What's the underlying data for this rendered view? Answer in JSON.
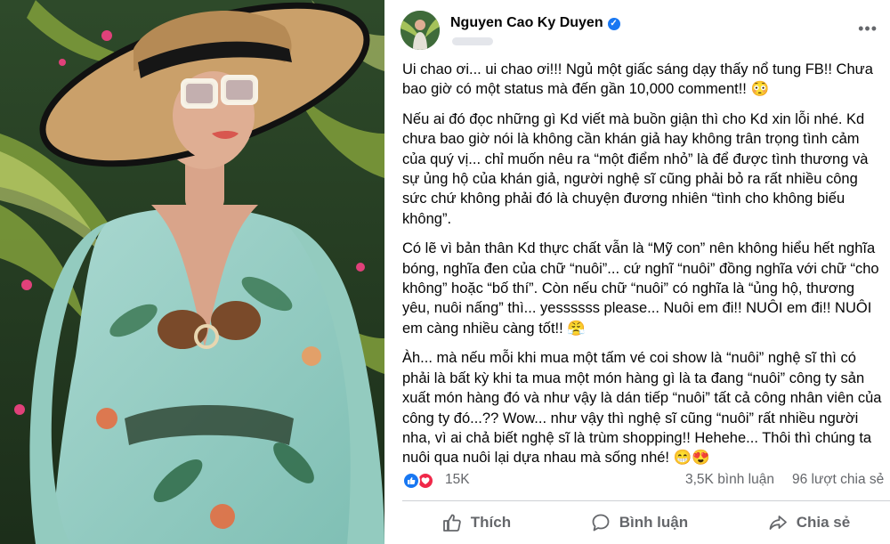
{
  "post": {
    "author": "Nguyen Cao Ky Duyen",
    "paragraphs": [
      "Ui chao ơi... ui chao ơi!!! Ngủ một giấc sáng dạy thấy nổ tung FB!! Chưa bao giờ có một status mà đến gần 10,000 comment!! 😳",
      "Nếu ai đó đọc những gì Kd viết mà buồn giận thì cho Kd xin lỗi nhé. Kd chưa bao giờ nói là không cần khán giả hay không trân trọng tình cảm của quý vị... chỉ muốn nêu ra “một điểm nhỏ” là để được tình thương và sự ủng hộ của khán giả, người nghệ sĩ cũng phải bỏ ra rất nhiều công sức chứ không phải đó là chuyện đương nhiên “tình cho không biếu không”.",
      "Có lẽ vì bản thân Kd thực chất vẫn là “Mỹ con” nên không hiểu hết nghĩa bóng, nghĩa đen của chữ “nuôi”... cứ nghĩ  “nuôi” đồng nghĩa với chữ  “cho không” hoặc “bố thí”.  Còn nếu chữ “nuôi” có nghĩa là “ủng hộ, thương yêu, nuôi nấng” thì... yessssss please... Nuôi em đi!! NUÔI em đi!! NUÔI em càng nhiều càng tốt!! 😤",
      "Àh... mà nếu mỗi khi mua một tấm vé coi show là “nuôi” nghệ sĩ thì có phải là bất kỳ khi ta mua một món hàng gì là ta đang “nuôi” công ty sản xuất món hàng đó và như vậy là dán tiếp “nuôi” tất cả công nhân viên của công ty đó...?? Wow... như vậy thì nghệ sĩ cũng “nuôi” rất nhiều người nha, vì ai chả biết nghệ sĩ là trùm shopping!! Hehehe... Thôi thì chúng ta nuôi qua nuôi lại dựa nhau mà sống nhé! 😁😍"
    ],
    "reactions_count": "15K",
    "comments_count": "3,5K bình luận",
    "shares_count": "96 lượt chia sẻ"
  },
  "actions": {
    "like": "Thích",
    "comment": "Bình luận",
    "share": "Chia sẻ"
  },
  "icons": {
    "verified": "verified-badge-icon",
    "more": "more-options-icon",
    "reactions": [
      "like-reaction-icon",
      "love-reaction-icon"
    ]
  },
  "colors": {
    "brand_blue": "#1877f2",
    "love_red": "#f02849",
    "muted_text": "#65676b"
  }
}
